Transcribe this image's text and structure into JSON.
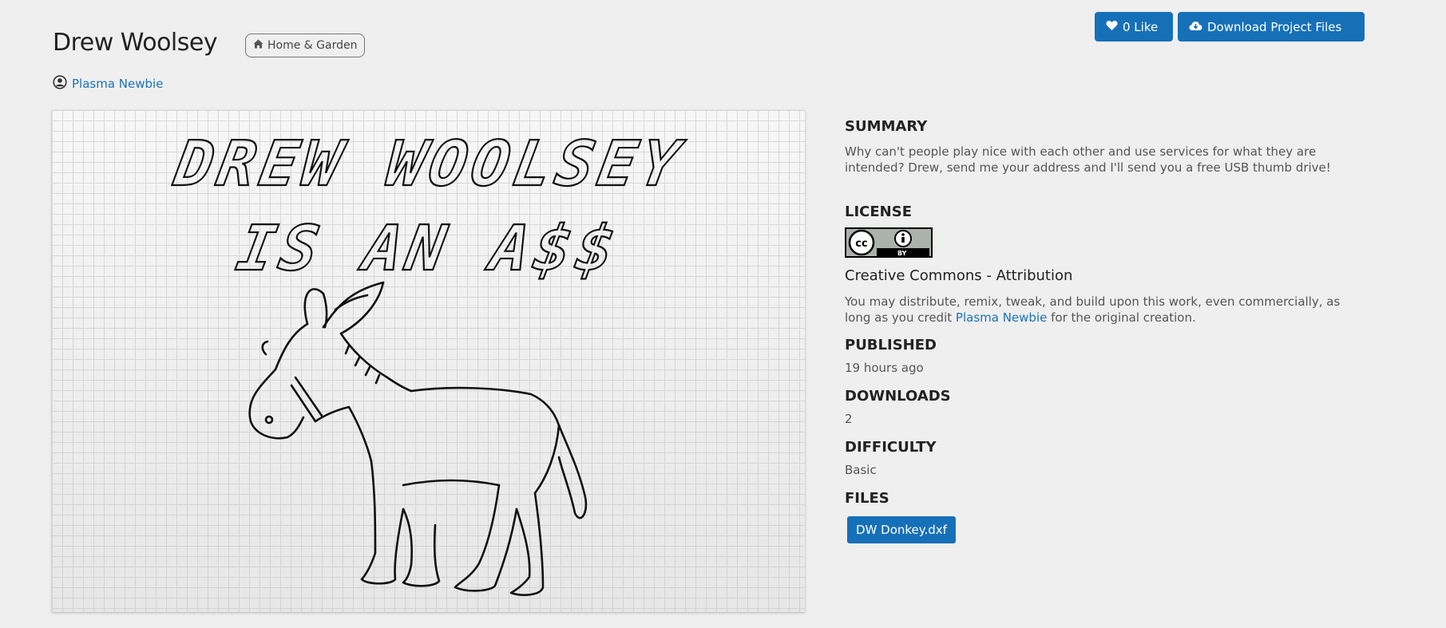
{
  "project": {
    "title": "Drew Woolsey",
    "category": "Home & Garden",
    "category_icon": "home-icon",
    "author": "Plasma Newbie",
    "author_icon": "user-circle-icon",
    "image_text_line1": "DREW WOOLSEY",
    "image_text_line2": "IS AN A$$"
  },
  "actions": {
    "like_label": "0 Like",
    "like_icon": "heart-icon",
    "download_label": "Download Project Files",
    "download_icon": "cloud-download-icon"
  },
  "details": {
    "summary_heading": "SUMMARY",
    "summary_text": "Why can't people play nice with each other and use services for what they are intended? Drew, send me your address and I'll send you a free USB thumb drive!",
    "license_heading": "LICENSE",
    "license_badge_text": "BY",
    "license_name": "Creative Commons - Attribution",
    "license_text_before": "You may distribute, remix, tweak, and build upon this work, even commercially, as long as you credit",
    "license_author_link": "Plasma Newbie",
    "license_text_after": "for the original creation.",
    "published_heading": "PUBLISHED",
    "published_value": "19 hours ago",
    "downloads_heading": "DOWNLOADS",
    "downloads_value": "2",
    "difficulty_heading": "DIFFICULTY",
    "difficulty_value": "Basic",
    "files_heading": "FILES",
    "files": [
      "DW Donkey.dxf"
    ]
  },
  "colors": {
    "primary": "#1670b8",
    "link": "#1a73b8",
    "background": "#efefef"
  }
}
